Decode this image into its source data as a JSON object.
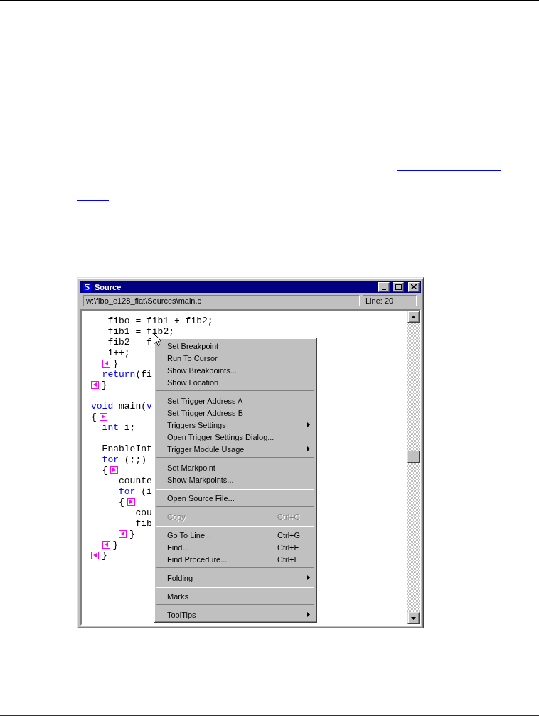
{
  "window": {
    "title": "Source",
    "path": "w:\\fibo_e128_flat\\Sources\\main.c",
    "line_indicator": "Line: 20"
  },
  "code": [
    {
      "kind": "code",
      "fold_start": false,
      "fold_end": false,
      "parts": [
        {
          "text": "   fibo = fib1 + fib2;",
          "kind": "plain"
        }
      ]
    },
    {
      "kind": "code",
      "fold_start": false,
      "fold_end": false,
      "parts": [
        {
          "text": "   fib1 = fib2;",
          "kind": "plain"
        }
      ]
    },
    {
      "kind": "code",
      "fold_start": false,
      "fold_end": false,
      "parts": [
        {
          "text": "   fib2 = f",
          "kind": "plain"
        }
      ]
    },
    {
      "kind": "code",
      "fold_start": false,
      "fold_end": false,
      "parts": [
        {
          "text": "   i++;",
          "kind": "plain"
        }
      ]
    },
    {
      "kind": "code",
      "fold_start": false,
      "fold_end": true,
      "parts": [
        {
          "text": "  }",
          "kind": "plain"
        }
      ]
    },
    {
      "kind": "code",
      "fold_start": false,
      "fold_end": false,
      "parts": [
        {
          "text": "  return",
          "kind": "keyword"
        },
        {
          "text": "(fi",
          "kind": "plain"
        }
      ]
    },
    {
      "kind": "code",
      "fold_start": false,
      "fold_end": true,
      "parts": [
        {
          "text": "}",
          "kind": "plain"
        }
      ]
    },
    {
      "kind": "blank"
    },
    {
      "kind": "code",
      "fold_start": false,
      "fold_end": false,
      "parts": [
        {
          "text": "void",
          "kind": "keyword"
        },
        {
          "text": " main(",
          "kind": "plain"
        },
        {
          "text": "v",
          "kind": "keyword"
        }
      ]
    },
    {
      "kind": "code",
      "fold_start": true,
      "fold_end": false,
      "parts": [
        {
          "text": "{",
          "kind": "plain"
        }
      ]
    },
    {
      "kind": "code",
      "fold_start": false,
      "fold_end": false,
      "parts": [
        {
          "text": "  int",
          "kind": "keyword"
        },
        {
          "text": " i;",
          "kind": "plain"
        }
      ]
    },
    {
      "kind": "blank"
    },
    {
      "kind": "code",
      "fold_start": false,
      "fold_end": false,
      "parts": [
        {
          "text": "  EnableInt",
          "kind": "plain"
        }
      ]
    },
    {
      "kind": "code",
      "fold_start": false,
      "fold_end": false,
      "parts": [
        {
          "text": "  for",
          "kind": "keyword"
        },
        {
          "text": " (;;)",
          "kind": "plain"
        }
      ]
    },
    {
      "kind": "code",
      "fold_start": true,
      "fold_end": false,
      "parts": [
        {
          "text": "  {",
          "kind": "plain"
        }
      ]
    },
    {
      "kind": "code",
      "fold_start": false,
      "fold_end": false,
      "parts": [
        {
          "text": "     counte",
          "kind": "plain"
        }
      ]
    },
    {
      "kind": "code",
      "fold_start": false,
      "fold_end": false,
      "parts": [
        {
          "text": "     for",
          "kind": "keyword"
        },
        {
          "text": " (i",
          "kind": "plain"
        }
      ]
    },
    {
      "kind": "code",
      "fold_start": true,
      "fold_end": false,
      "parts": [
        {
          "text": "     {",
          "kind": "plain"
        }
      ]
    },
    {
      "kind": "code",
      "fold_start": false,
      "fold_end": false,
      "parts": [
        {
          "text": "        cou",
          "kind": "plain"
        }
      ]
    },
    {
      "kind": "code",
      "fold_start": false,
      "fold_end": false,
      "parts": [
        {
          "text": "        fib",
          "kind": "plain"
        }
      ]
    },
    {
      "kind": "code",
      "fold_start": false,
      "fold_end": true,
      "parts": [
        {
          "text": "     }",
          "kind": "plain"
        }
      ]
    },
    {
      "kind": "code",
      "fold_start": false,
      "fold_end": true,
      "parts": [
        {
          "text": "  }",
          "kind": "plain"
        }
      ]
    },
    {
      "kind": "code",
      "fold_start": false,
      "fold_end": true,
      "parts": [
        {
          "text": "}",
          "kind": "plain"
        }
      ]
    }
  ],
  "context_menu": {
    "groups": [
      [
        {
          "label": "Set Breakpoint",
          "disabled": false
        },
        {
          "label": "Run To Cursor",
          "disabled": false
        },
        {
          "label": "Show Breakpoints...",
          "disabled": false
        },
        {
          "label": "Show Location",
          "disabled": false
        }
      ],
      [
        {
          "label": "Set Trigger Address A",
          "disabled": false
        },
        {
          "label": "Set Trigger Address B",
          "disabled": false
        },
        {
          "label": "Triggers Settings",
          "disabled": false,
          "submenu": true
        },
        {
          "label": "Open Trigger Settings Dialog...",
          "disabled": false
        },
        {
          "label": "Trigger Module Usage",
          "disabled": false,
          "submenu": true
        }
      ],
      [
        {
          "label": "Set Markpoint",
          "disabled": false
        },
        {
          "label": "Show Markpoints...",
          "disabled": false
        }
      ],
      [
        {
          "label": "Open Source File...",
          "disabled": false
        }
      ],
      [
        {
          "label": "Copy",
          "shortcut": "Ctrl+C",
          "disabled": true
        }
      ],
      [
        {
          "label": "Go To Line...",
          "shortcut": "Ctrl+G",
          "disabled": false
        },
        {
          "label": "Find...",
          "shortcut": "Ctrl+F",
          "disabled": false
        },
        {
          "label": "Find Procedure...",
          "shortcut": "Ctrl+I",
          "disabled": false
        }
      ],
      [
        {
          "label": "Folding",
          "disabled": false,
          "submenu": true
        }
      ],
      [
        {
          "label": "Marks",
          "disabled": false
        }
      ],
      [
        {
          "label": "ToolTips",
          "disabled": false,
          "submenu": true
        }
      ]
    ]
  }
}
